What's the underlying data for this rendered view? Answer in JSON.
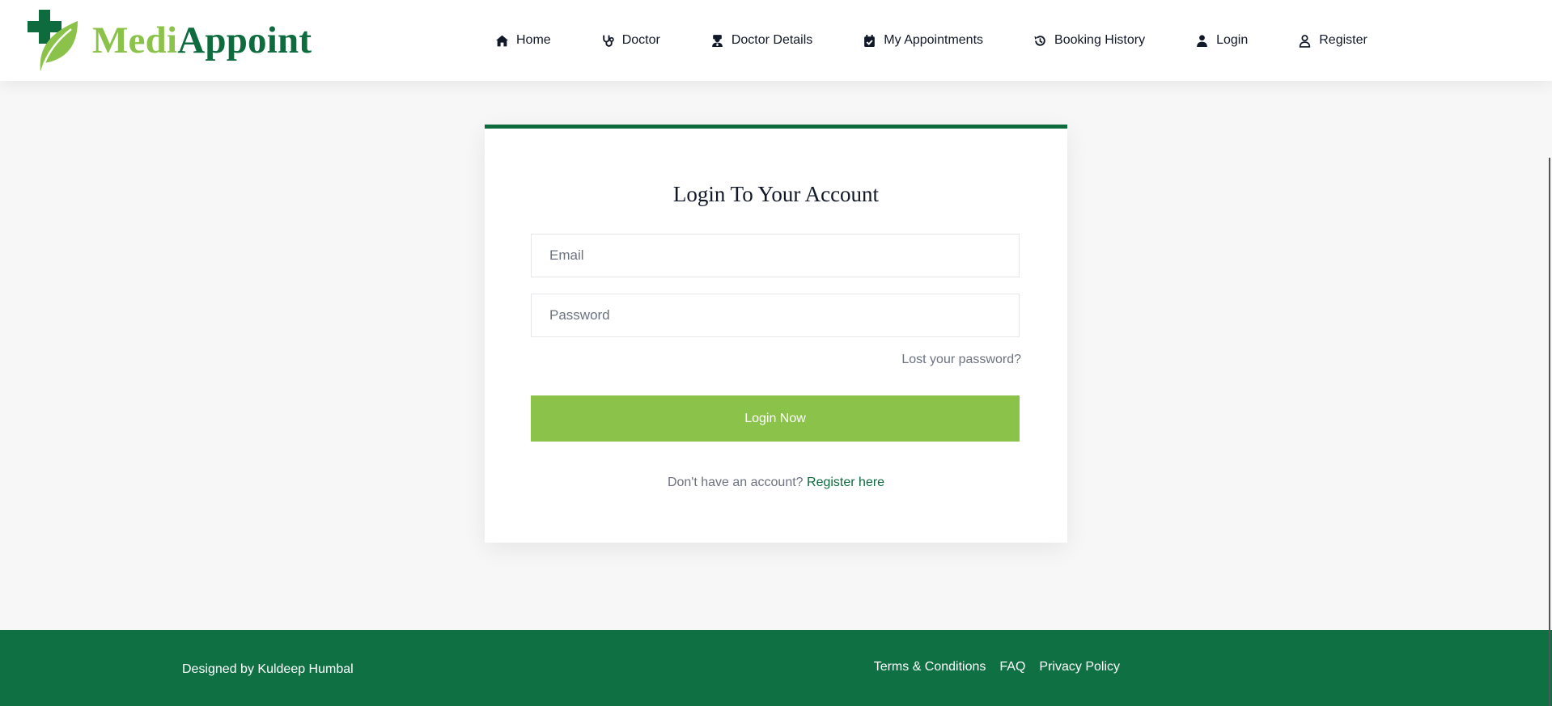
{
  "brand": {
    "name_part1": "Medi",
    "name_part2": "Appoint",
    "colors": {
      "primary": "#0d6b3e",
      "accent": "#8bc34a"
    }
  },
  "nav": {
    "items": [
      {
        "label": "Home",
        "icon": "home-icon"
      },
      {
        "label": "Doctor",
        "icon": "stethoscope-icon"
      },
      {
        "label": "Doctor Details",
        "icon": "doctor-icon"
      },
      {
        "label": "My Appointments",
        "icon": "calendar-check-icon"
      },
      {
        "label": "Booking History",
        "icon": "history-icon"
      },
      {
        "label": "Login",
        "icon": "user-solid-icon"
      },
      {
        "label": "Register",
        "icon": "user-outline-icon"
      }
    ]
  },
  "login": {
    "title": "Login To Your Account",
    "email_placeholder": "Email",
    "password_placeholder": "Password",
    "lost_password": "Lost your password?",
    "submit_label": "Login Now",
    "no_account_text": "Don't have an account?",
    "register_link": "Register here"
  },
  "footer": {
    "credit": "Designed by Kuldeep Humbal",
    "links": [
      "Terms & Conditions",
      "FAQ",
      "Privacy Policy"
    ],
    "background": "#0f7043"
  }
}
